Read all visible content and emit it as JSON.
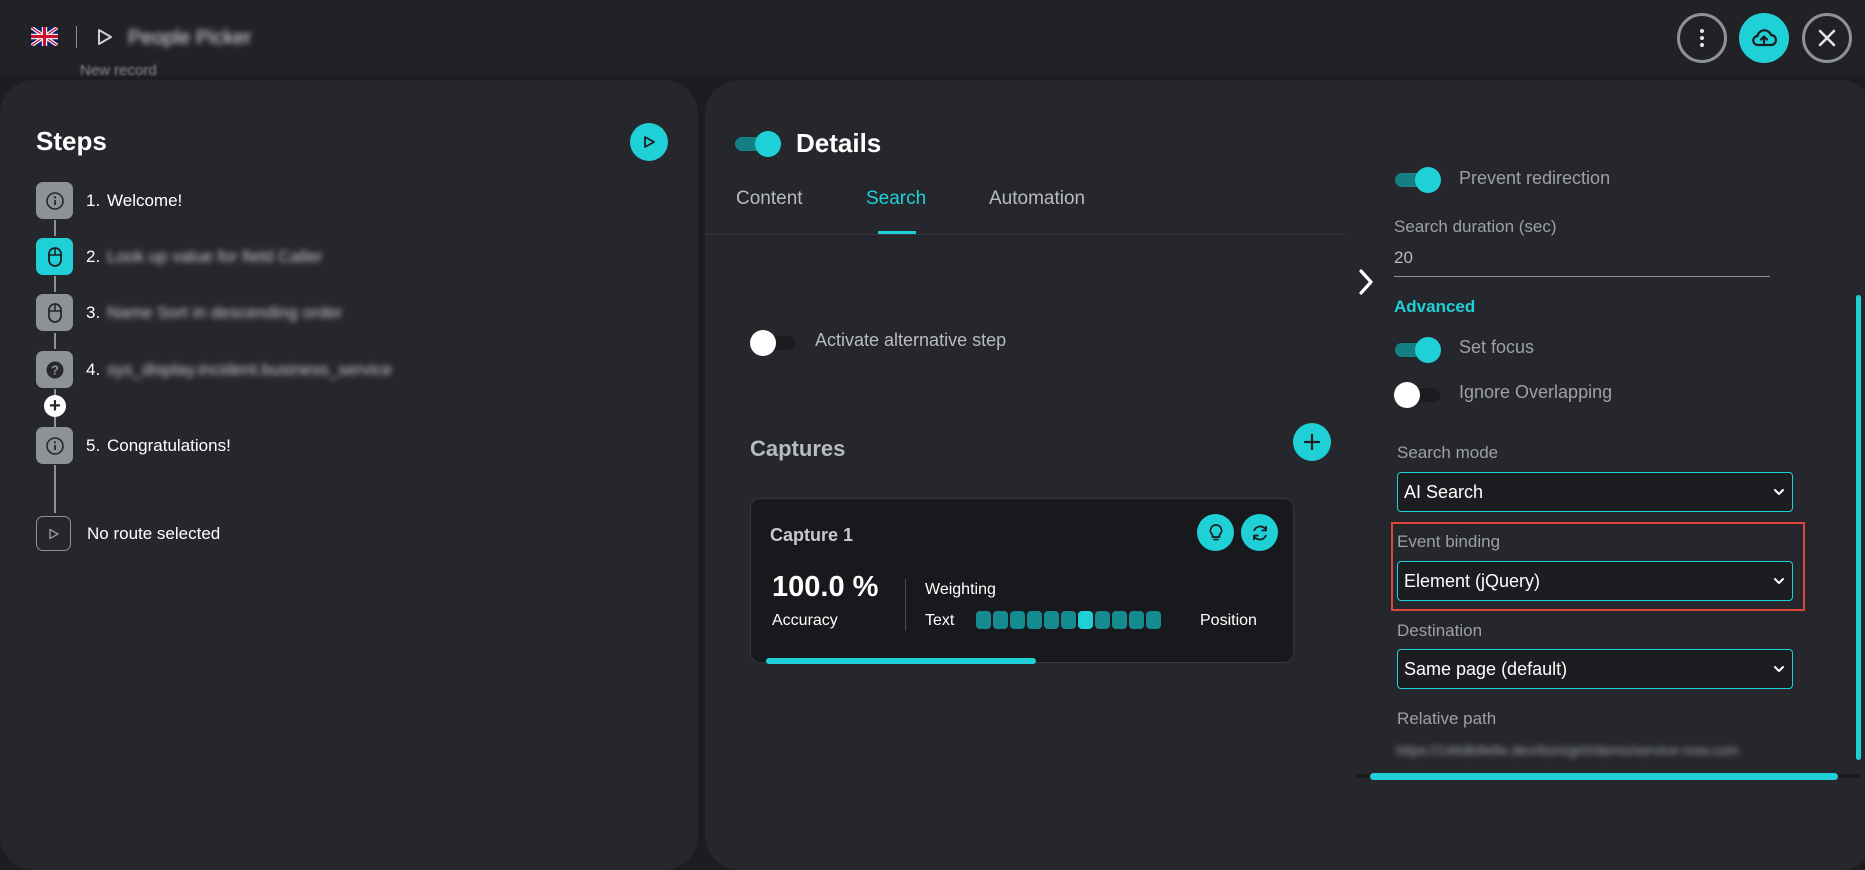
{
  "header": {
    "behind_text": "New record",
    "title": "People Picker",
    "icons": [
      "uk-flag-icon",
      "play-icon",
      "more-vertical-icon",
      "cloud-upload-icon",
      "close-icon"
    ]
  },
  "steps": {
    "title": "Steps",
    "items": [
      {
        "num": "1.",
        "label": "Welcome!",
        "icon": "info-icon"
      },
      {
        "num": "2.",
        "label": "Look up value for field Caller",
        "icon": "mouse-icon"
      },
      {
        "num": "3.",
        "label": "Name Sort in descending order",
        "icon": "mouse-icon"
      },
      {
        "num": "4.",
        "label": "sys_display.incident.business_service",
        "icon": "question-icon"
      },
      {
        "num": "5.",
        "label": "Congratulations!",
        "icon": "info-icon"
      }
    ],
    "route_label": "No route selected"
  },
  "details": {
    "title": "Details",
    "tabs": [
      "Content",
      "Search",
      "Automation"
    ],
    "active_tab": "Search",
    "alt_step_label": "Activate alternative step",
    "captures_title": "Captures",
    "capture": {
      "title": "Capture 1",
      "accuracy": "100.0 %",
      "accuracy_label": "Accuracy",
      "weighting_label": "Weighting",
      "text_label": "Text",
      "position_label": "Position",
      "weighting_active_index": 6,
      "weighting_segments": 11
    }
  },
  "settings": {
    "prevent_redirection": "Prevent redirection",
    "search_duration_label": "Search duration (sec)",
    "search_duration_value": "20",
    "advanced": "Advanced",
    "set_focus": "Set focus",
    "ignore_overlapping": "Ignore Overlapping",
    "search_mode_label": "Search mode",
    "search_mode_value": "AI Search",
    "event_binding_label": "Event binding",
    "event_binding_value": "Element (jQuery)",
    "destination_label": "Destination",
    "destination_value": "Same page (default)",
    "relative_path_label": "Relative path",
    "relative_path_value": "https://146db8e8e.dev/itsm/gir0/demo/service-now.com"
  },
  "colors": {
    "accent": "#1fd1d6",
    "highlight": "#e0473c",
    "panel": "#25272c",
    "background": "#1b1d21"
  }
}
